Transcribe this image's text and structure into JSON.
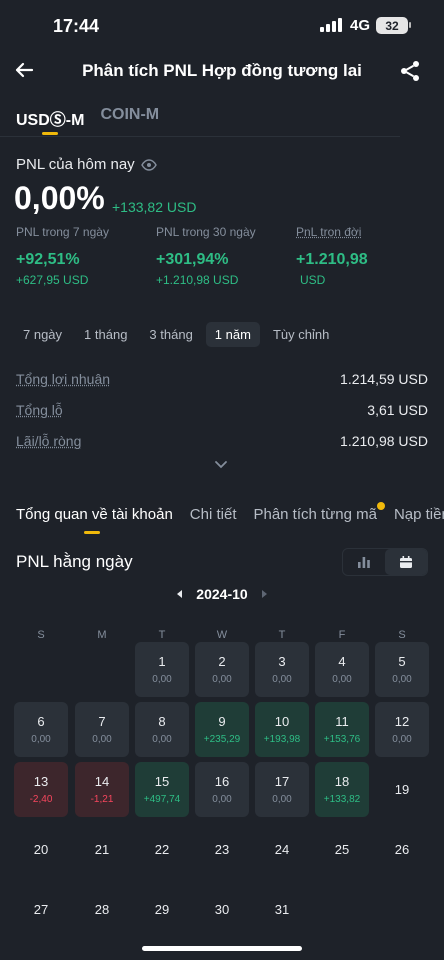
{
  "status": {
    "time": "17:44",
    "network": "4G",
    "battery": "32"
  },
  "header": {
    "title": "Phân tích PNL Hợp đồng tương lai"
  },
  "margin_tabs": [
    "USDⓈ-M",
    "COIN-M"
  ],
  "today": {
    "label": "PNL của hôm nay",
    "percent": "0,00%",
    "usd": "+133,82 USD"
  },
  "stats": [
    {
      "label": "PNL trong 7 ngày",
      "value": "+92,51%",
      "sub": "+627,95 USD"
    },
    {
      "label": "PNL trong 30 ngày",
      "value": "+301,94%",
      "sub": "+1.210,98 USD"
    },
    {
      "label": "PnL trọn đời",
      "value": "+1.210,98",
      "sub": "USD"
    }
  ],
  "periods": [
    "7 ngày",
    "1 tháng",
    "3 tháng",
    "1 năm",
    "Tùy chỉnh"
  ],
  "summary": [
    {
      "label": "Tổng lợi nhuận",
      "value": "1.214,59 USD"
    },
    {
      "label": "Tổng lỗ",
      "value": "3,61 USD"
    },
    {
      "label": "Lãi/lỗ ròng",
      "value": "1.210,98 USD"
    }
  ],
  "section_tabs": [
    "Tổng quan về tài khoản",
    "Chi tiết",
    "Phân tích từng mã",
    "Nạp tiền"
  ],
  "daily": {
    "title": "PNL hằng ngày",
    "month": "2024-10",
    "weekdays": [
      "S",
      "M",
      "T",
      "W",
      "T",
      "F",
      "S"
    ],
    "days": [
      {
        "d": "1",
        "p": "0,00",
        "t": "n"
      },
      {
        "d": "2",
        "p": "0,00",
        "t": "n"
      },
      {
        "d": "3",
        "p": "0,00",
        "t": "n"
      },
      {
        "d": "4",
        "p": "0,00",
        "t": "n"
      },
      {
        "d": "5",
        "p": "0,00",
        "t": "n"
      },
      {
        "d": "6",
        "p": "0,00",
        "t": "n"
      },
      {
        "d": "7",
        "p": "0,00",
        "t": "n"
      },
      {
        "d": "8",
        "p": "0,00",
        "t": "n"
      },
      {
        "d": "9",
        "p": "+235,29",
        "t": "g"
      },
      {
        "d": "10",
        "p": "+193,98",
        "t": "g"
      },
      {
        "d": "11",
        "p": "+153,76",
        "t": "g"
      },
      {
        "d": "12",
        "p": "0,00",
        "t": "n"
      },
      {
        "d": "13",
        "p": "-2,40",
        "t": "r"
      },
      {
        "d": "14",
        "p": "-1,21",
        "t": "r"
      },
      {
        "d": "15",
        "p": "+497,74",
        "t": "g"
      },
      {
        "d": "16",
        "p": "0,00",
        "t": "n"
      },
      {
        "d": "17",
        "p": "0,00",
        "t": "n"
      },
      {
        "d": "18",
        "p": "+133,82",
        "t": "g"
      },
      {
        "d": "19",
        "p": "",
        "t": "e"
      },
      {
        "d": "20",
        "p": "",
        "t": "e"
      },
      {
        "d": "21",
        "p": "",
        "t": "e"
      },
      {
        "d": "22",
        "p": "",
        "t": "e"
      },
      {
        "d": "23",
        "p": "",
        "t": "e"
      },
      {
        "d": "24",
        "p": "",
        "t": "e"
      },
      {
        "d": "25",
        "p": "",
        "t": "e"
      },
      {
        "d": "26",
        "p": "",
        "t": "e"
      },
      {
        "d": "27",
        "p": "",
        "t": "e"
      },
      {
        "d": "28",
        "p": "",
        "t": "e"
      },
      {
        "d": "29",
        "p": "",
        "t": "e"
      },
      {
        "d": "30",
        "p": "",
        "t": "e"
      },
      {
        "d": "31",
        "p": "",
        "t": "e"
      }
    ]
  },
  "colors": {
    "accent": "#f0b90b",
    "positive": "#2ebd85",
    "negative": "#f6465d",
    "background": "#1e2229"
  }
}
